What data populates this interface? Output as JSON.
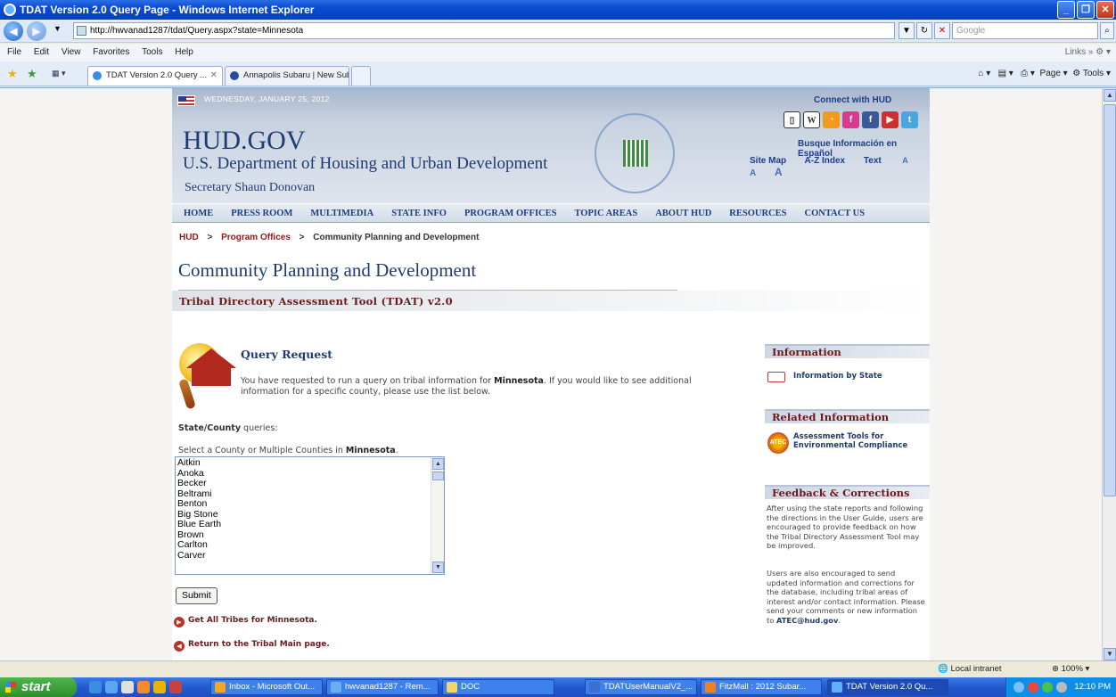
{
  "window": {
    "title": "TDAT Version 2.0 Query Page - Windows Internet Explorer",
    "url": "http://hwvanad1287/tdat/Query.aspx?state=Minnesota",
    "search_placeholder": "Google"
  },
  "menu": {
    "items": [
      "File",
      "Edit",
      "View",
      "Favorites",
      "Tools",
      "Help"
    ],
    "links_label": "Links"
  },
  "tabs": [
    {
      "label": "TDAT Version 2.0 Query ...",
      "active": true
    },
    {
      "label": "Annapolis Subaru | New Sub...",
      "active": false
    }
  ],
  "command_bar": {
    "page": "Page",
    "tools": "Tools"
  },
  "header": {
    "date": "WEDNESDAY, JANUARY 25, 2012",
    "logo": "HUD.GOV",
    "department": "U.S. Department of Housing and Urban Development",
    "secretary": "Secretary Shaun Donovan",
    "connect": "Connect with HUD",
    "espanol": "Busque Información en Español",
    "site_map": "Site Map",
    "az_index": "A-Z Index",
    "text_label": "Text",
    "text_sizes": [
      "A",
      "A",
      "A"
    ]
  },
  "nav": [
    "HOME",
    "PRESS ROOM",
    "MULTIMEDIA",
    "STATE INFO",
    "PROGRAM OFFICES",
    "TOPIC AREAS",
    "ABOUT HUD",
    "RESOURCES",
    "CONTACT US"
  ],
  "breadcrumb": {
    "home": "HUD",
    "sep": ">",
    "offices": "Program Offices",
    "current": "Community Planning and Development"
  },
  "page": {
    "title": "Community Planning and Development",
    "subtitle": "Tribal Directory Assessment Tool (TDAT) v2.0"
  },
  "query": {
    "title": "Query Request",
    "text_before": "You have requested to run a query on tribal information for ",
    "state": "Minnesota",
    "text_after": ". If you would like to see additional information for a specific county, please use the list below.",
    "state_county_label": "State/County",
    "queries_word": " queries:",
    "select_label": "Select a County or Multiple Counties in ",
    "select_label_end": ".",
    "counties": [
      "Aitkin",
      "Anoka",
      "Becker",
      "Beltrami",
      "Benton",
      "Big Stone",
      "Blue Earth",
      "Brown",
      "Carlton",
      "Carver"
    ],
    "submit_label": "Submit",
    "get_all_tribes": "Get All Tribes for Minnesota.",
    "return_link": "Return to the Tribal Main page."
  },
  "sidebar": {
    "information_head": "Information",
    "info_by_state": "Information by State",
    "related_head": "Related Information",
    "atec_link": "Assessment Tools for Environmental Compliance",
    "atec_badge": "ATEC",
    "feedback_head": "Feedback & Corrections",
    "feedback_p1": "After using the state reports and following the directions in the User Guide, users are encouraged to provide feedback on how the Tribal Directory Assessment Tool may be improved.",
    "feedback_p2": "Users are also encouraged to send updated information and corrections for the database, including tribal areas of interest and/or contact information. Please send your comments or new information to ",
    "feedback_email": "ATEC@hud.gov",
    "feedback_end": "."
  },
  "status": {
    "zone": "Local intranet",
    "zoom": "100%"
  },
  "taskbar": {
    "start": "start",
    "tasks": [
      {
        "label": "Inbox - Microsoft Out...",
        "active": false
      },
      {
        "label": "hwvanad1287 - Rem...",
        "active": false
      },
      {
        "label": "DOC",
        "active": false
      },
      {
        "label": "TDATUserManualV2_...",
        "active": false
      },
      {
        "label": "FitzMall : 2012 Subar...",
        "active": false
      },
      {
        "label": "TDAT Version 2.0 Qu...",
        "active": true
      }
    ],
    "clock": "12:10 PM"
  }
}
